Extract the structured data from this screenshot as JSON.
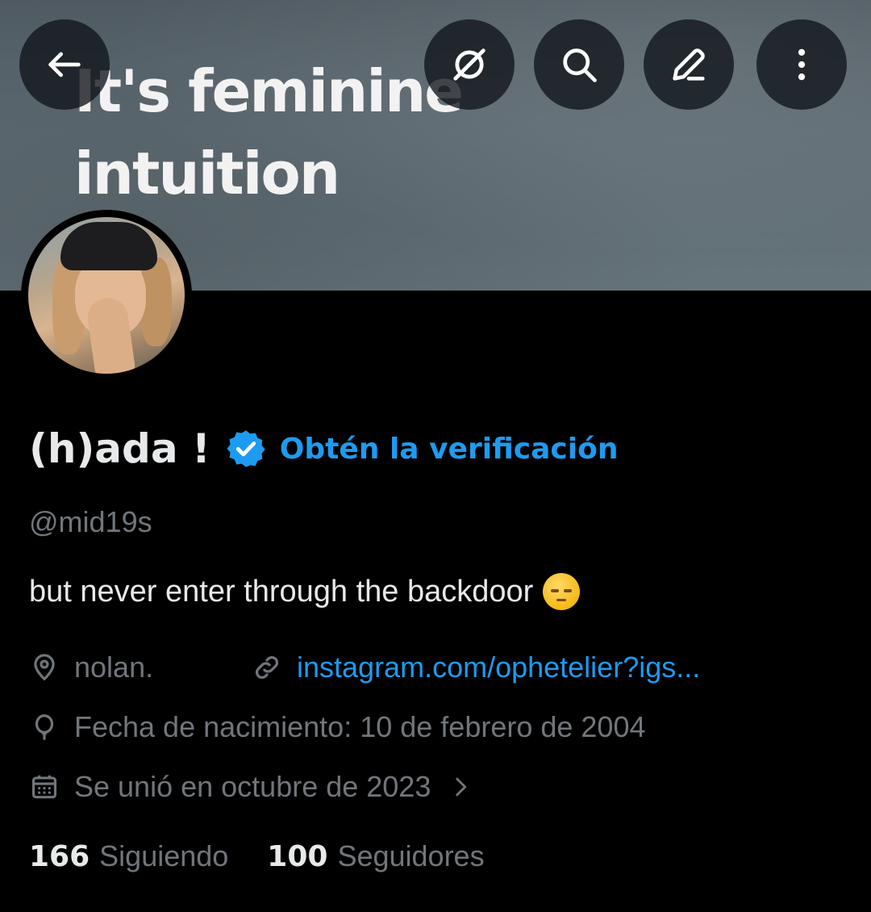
{
  "banner": {
    "line1": "It's feminine",
    "line2": "intuition"
  },
  "toolbar": {
    "back_icon": "arrow-left-icon",
    "grok_icon": "grok-icon",
    "search_icon": "search-icon",
    "edit_icon": "edit-pencil-icon",
    "more_icon": "more-vertical-icon"
  },
  "profile": {
    "display_name": "(h)ada !",
    "verified_badge": "verified-badge-icon",
    "get_verified": "Obtén la verificación",
    "handle": "@mid19s",
    "bio": "but never enter through the backdoor",
    "bio_emoji": "relieved-face-emoji"
  },
  "meta": {
    "location": "nolan.",
    "link": "instagram.com/ophetelier?igs...",
    "birthday": "Fecha de nacimiento: 10 de febrero de 2004",
    "joined": "Se unió en octubre de 2023"
  },
  "stats": {
    "following_count": "166",
    "following_label": "Siguiendo",
    "followers_count": "100",
    "followers_label": "Seguidores"
  },
  "colors": {
    "accent": "#1d9bf0",
    "muted": "#71767b",
    "text": "#e7e9ea",
    "background": "#000000"
  }
}
